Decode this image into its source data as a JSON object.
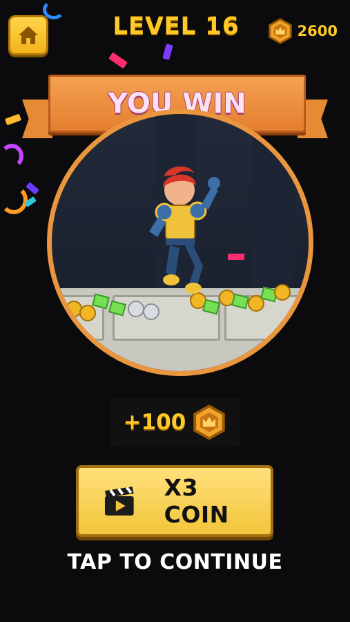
{
  "header": {
    "level_title": "LEVEL 16",
    "coin_balance": "2600",
    "home_icon": "home-icon",
    "coin_icon": "crown-coin-icon"
  },
  "banner": {
    "title": "YOU WIN"
  },
  "reward": {
    "amount": "+100",
    "icon": "crown-coin-icon"
  },
  "actions": {
    "multiply_label": "X3 COIN",
    "multiply_icon": "video-clapper-icon",
    "continue_label": "TAP TO CONTINUE"
  },
  "colors": {
    "accent_gold": "#ffc928",
    "banner_orange": "#e8883a",
    "banner_text": "#ffe0f2",
    "background": "#0b0b0d"
  }
}
